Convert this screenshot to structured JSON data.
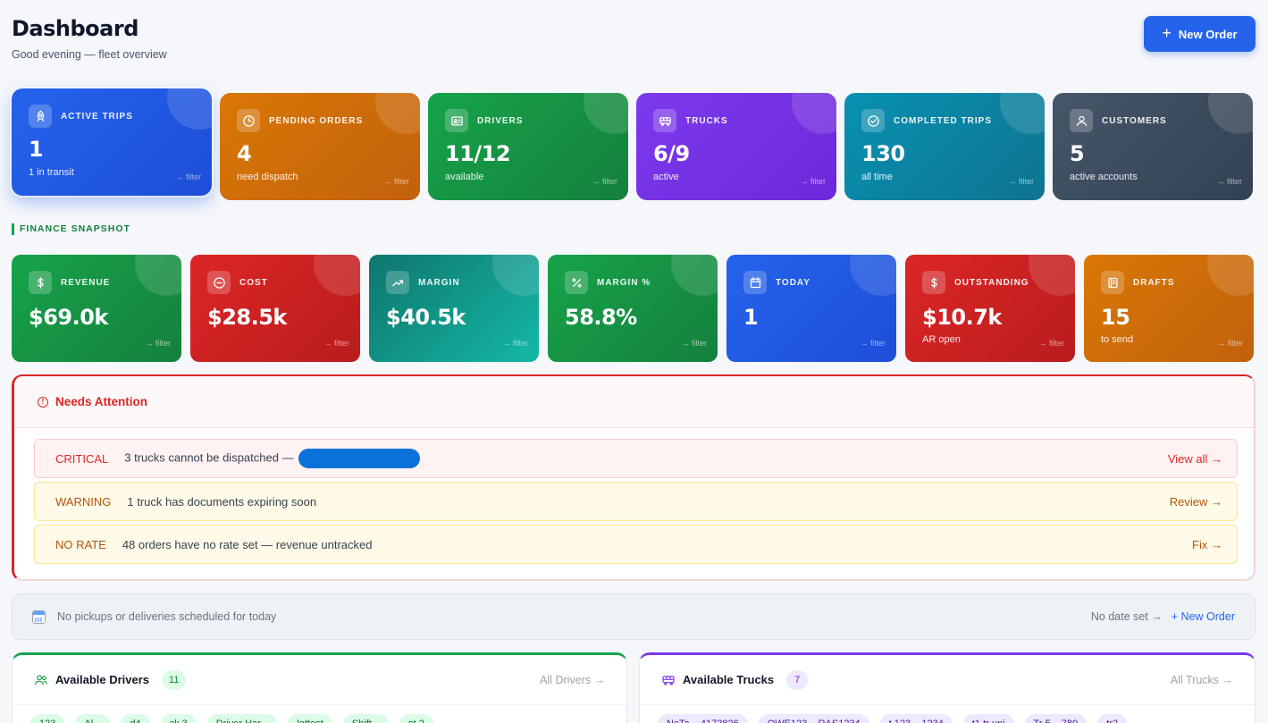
{
  "header": {
    "title": "Dashboard",
    "subtitle": "Good evening — fleet overview",
    "new_order_label": "New Order"
  },
  "kpis": [
    {
      "label": "ACTIVE TRIPS",
      "value": "1",
      "sub": "1 in transit",
      "filter": "→ filter",
      "icon": "rocket-icon",
      "color": "#2563eb"
    },
    {
      "label": "PENDING ORDERS",
      "value": "4",
      "sub": "need dispatch",
      "filter": "→ filter",
      "icon": "clock-icon",
      "color": "#d97706"
    },
    {
      "label": "DRIVERS",
      "value": "11/12",
      "sub": "available",
      "filter": "→ filter",
      "icon": "id-card-icon",
      "color": "#16a34a"
    },
    {
      "label": "TRUCKS",
      "value": "6/9",
      "sub": "active",
      "filter": "→ filter",
      "icon": "truck-icon",
      "color": "#7c3aed"
    },
    {
      "label": "COMPLETED TRIPS",
      "value": "130",
      "sub": "all time",
      "filter": "→ filter",
      "icon": "check-circle-icon",
      "color": "#0891b2"
    },
    {
      "label": "CUSTOMERS",
      "value": "5",
      "sub": "active accounts",
      "filter": "→ filter",
      "icon": "user-icon",
      "color": "#475569"
    }
  ],
  "finance": {
    "section_label": "FINANCE SNAPSHOT",
    "cards": [
      {
        "label": "REVENUE",
        "value": "$69.0k",
        "sub": "",
        "filter": "→ filter",
        "icon": "dollar-icon",
        "color": "#16a34a"
      },
      {
        "label": "COST",
        "value": "$28.5k",
        "sub": "",
        "filter": "→ filter",
        "icon": "minus-circle-icon",
        "color": "#dc2626"
      },
      {
        "label": "MARGIN",
        "value": "$40.5k",
        "sub": "",
        "filter": "→ filter",
        "icon": "trend-up-icon",
        "color": "#0f766e"
      },
      {
        "label": "MARGIN %",
        "value": "58.8%",
        "sub": "",
        "filter": "→ filter",
        "icon": "percent-icon",
        "color": "#16a34a"
      },
      {
        "label": "TODAY",
        "value": "1",
        "sub": "",
        "filter": "→ filter",
        "icon": "calendar-icon",
        "color": "#2563eb"
      },
      {
        "label": "OUTSTANDING",
        "value": "$10.7k",
        "sub": "AR open",
        "filter": "→ filter",
        "icon": "dollar-icon",
        "color": "#dc2626"
      },
      {
        "label": "DRAFTS",
        "value": "15",
        "sub": "to send",
        "filter": "→ filter",
        "icon": "document-icon",
        "color": "#d97706"
      }
    ]
  },
  "attention": {
    "title": "Needs Attention",
    "alerts": [
      {
        "tag": "CRITICAL",
        "message": "3 trucks cannot be dispatched —",
        "action": "View all →"
      },
      {
        "tag": "WARNING",
        "message": "1 truck has documents expiring soon",
        "action": "Review →"
      },
      {
        "tag": "NO RATE",
        "message": "48 orders have no rate set — revenue untracked",
        "action": "Fix →"
      }
    ]
  },
  "today_bar": {
    "message": "No pickups or deliveries scheduled for today",
    "no_date_label": "No date set →",
    "new_order_label": "+ New Order"
  },
  "drivers_panel": {
    "title": "Available Drivers",
    "count": "11",
    "link": "All Drivers →",
    "chips": [
      "123",
      "Al...",
      "d4",
      "ck 3",
      "Driver Har...",
      "lattest",
      "Shift...",
      "st 2"
    ]
  },
  "trucks_panel": {
    "title": "Available Trucks",
    "count": "7",
    "link": "All Trucks →",
    "chips": [
      "NeTa... 4172826",
      "QWE123... RAS1234",
      "t 123... 1234",
      "t1 tr uni",
      "Tr 5... 789",
      "tr2"
    ]
  },
  "colors": {
    "accent": "#2563eb",
    "critical": "#dc2626",
    "warning": "#b45309",
    "page_bg": "#f5f7fb"
  }
}
